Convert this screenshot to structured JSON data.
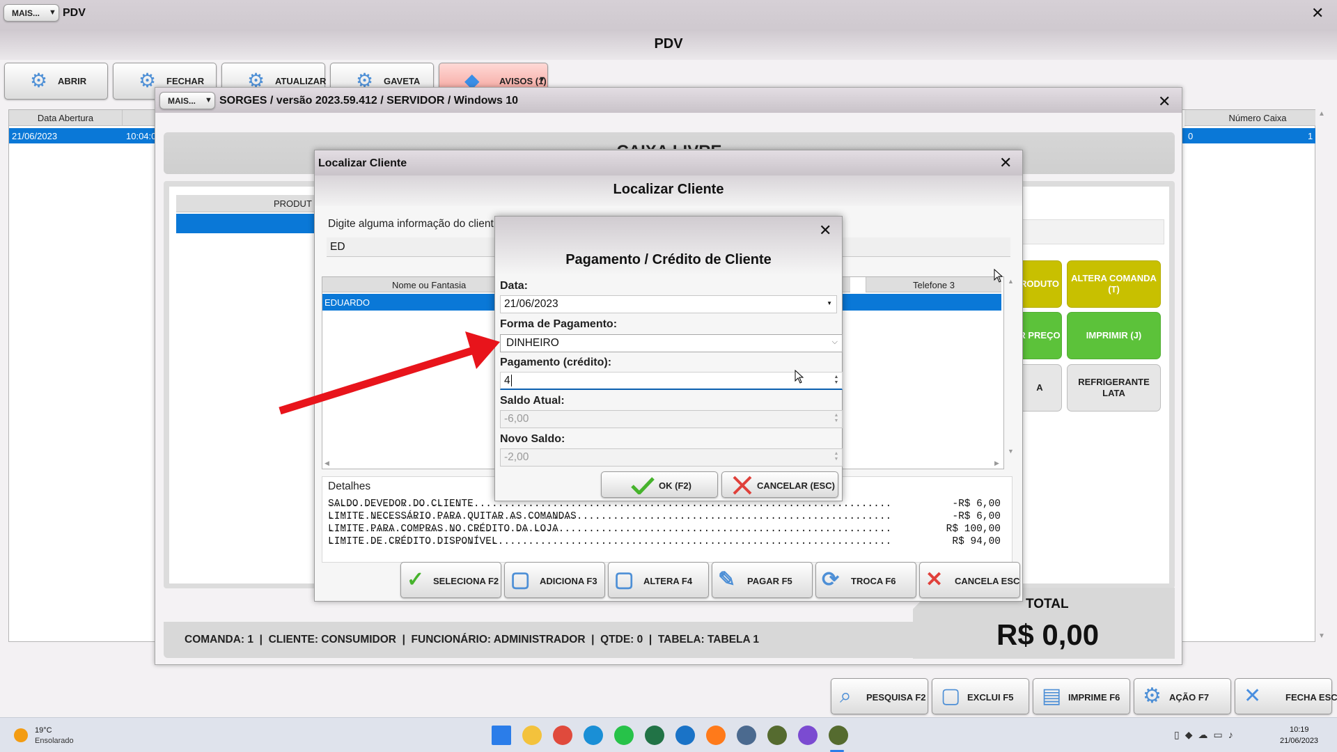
{
  "main_window": {
    "menu_button": "MAIS...",
    "app_name": "PDV",
    "heading": "PDV",
    "top_buttons": [
      "ABRIR",
      "FECHAR",
      "ATUALIZAR",
      "GAVETA",
      "AVISOS (1)"
    ],
    "table": {
      "col_data_abertura": "Data Abertura",
      "col_numero_caixa": "Número Caixa",
      "row_date": "21/06/2023",
      "row_time": "10:04:0",
      "row_mid": "0",
      "row_caixa": "1"
    },
    "bottom_buttons": [
      "PESQUISA F2",
      "EXCLUI F5",
      "IMPRIME F6",
      "AÇÃO F7",
      "FECHA ESC"
    ]
  },
  "caixa_window": {
    "menu_button": "MAIS...",
    "title": "SORGES / versão 2023.59.412 / SERVIDOR / Windows 10",
    "banner": "CAIXA LIVRE",
    "produto_header": "PRODUT",
    "tiles": [
      {
        "label": "RODUTO",
        "color": "#c8c000"
      },
      {
        "label": "ALTERA COMANDA (T)",
        "color": "#c8c000"
      },
      {
        "label": "R PREÇO",
        "color": "#5cc23a"
      },
      {
        "label": "IMPRIMIR (J)",
        "color": "#5cc23a"
      },
      {
        "label": "A",
        "color": "#e6e6e6"
      },
      {
        "label": "REFRIGERANTE LATA",
        "color": "#e6e6e6"
      }
    ],
    "status_line": "COMANDA: 1  |  CLIENTE: CONSUMIDOR  |  FUNCIONÁRIO: ADMINISTRADOR  |  QTDE: 0  |  TABELA: TABELA 1",
    "total_label": "TOTAL",
    "total_value": "R$ 0,00"
  },
  "localizar_window": {
    "titlebar": "Localizar Cliente",
    "heading": "Localizar Cliente",
    "search_label": "Digite alguma informação do client",
    "search_value": "ED",
    "col_nome": "Nome ou Fantasia",
    "col_telefone": "Telefone 3",
    "row_nome": "EDUARDO",
    "detalhes_label": "Detalhes",
    "detalhes_lines": [
      {
        "label": "SALDO DEVEDOR DO CLIENTE",
        "value": "-R$ 6,00"
      },
      {
        "label": "LIMITE NECESSÁRIO PARA QUITAR AS COMANDAS",
        "value": "-R$ 6,00"
      },
      {
        "label": "LIMITE PARA COMPRAS NO CRÉDITO DA LOJA",
        "value": "R$ 100,00"
      },
      {
        "label": "LIMITE DE CRÉDITO DISPONÍVEL",
        "value": "R$ 94,00"
      }
    ],
    "buttons": [
      "SELECIONA F2",
      "ADICIONA F3",
      "ALTERA F4",
      "PAGAR F5",
      "TROCA F6",
      "CANCELA ESC"
    ]
  },
  "pagamento_dialog": {
    "title": "Pagamento / Crédito de Cliente",
    "data_label": "Data:",
    "data_value": "21/06/2023",
    "forma_label": "Forma de Pagamento:",
    "forma_value": "DINHEIRO",
    "pagamento_label": "Pagamento (crédito):",
    "pagamento_value": "4",
    "saldo_atual_label": "Saldo Atual:",
    "saldo_atual_value": "-6,00",
    "novo_saldo_label": "Novo Saldo:",
    "novo_saldo_value": "-2,00",
    "ok_label": "OK (F2)",
    "cancel_label": "CANCELAR (ESC)"
  },
  "taskbar": {
    "weather_temp": "19°C",
    "weather_desc": "Ensolarado",
    "time": "10:19",
    "date": "21/06/2023"
  },
  "colors": {
    "selection": "#0a78d7",
    "annotation_arrow": "#e8141b",
    "yellow_tile": "#c8c000",
    "green_tile": "#5cc23a"
  }
}
